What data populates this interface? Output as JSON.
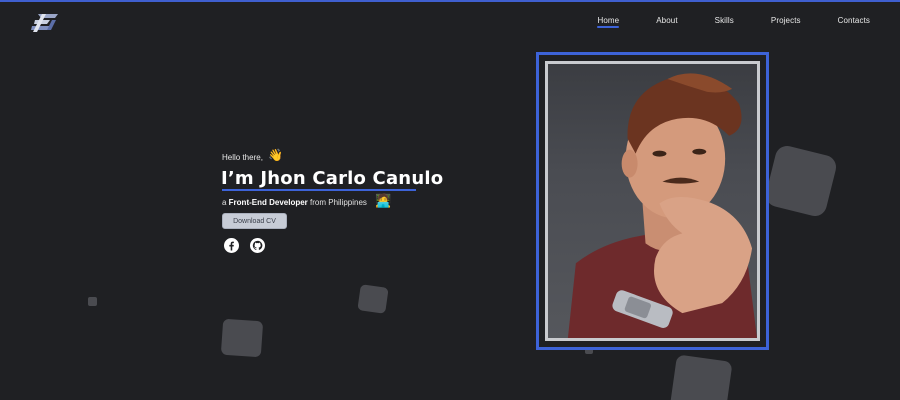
{
  "nav": {
    "items": [
      {
        "label": "Home",
        "active": true
      },
      {
        "label": "About",
        "active": false
      },
      {
        "label": "Skills",
        "active": false
      },
      {
        "label": "Projects",
        "active": false
      },
      {
        "label": "Contacts",
        "active": false
      }
    ]
  },
  "hero": {
    "greeting": "Hello there,",
    "greeting_emoji": "👋",
    "name": "I’m Jhon Carlo Canulo",
    "tagline_prefix": "a ",
    "tagline_role": "Front-End Developer",
    "tagline_suffix": " from Philippines",
    "tagline_emoji": "🧑‍💻",
    "cv_button": "Download CV"
  },
  "social": [
    "facebook-icon",
    "github-icon"
  ],
  "colors": {
    "background": "#1f2023",
    "accent": "#3d63d8",
    "button": "#c7ccd6"
  }
}
